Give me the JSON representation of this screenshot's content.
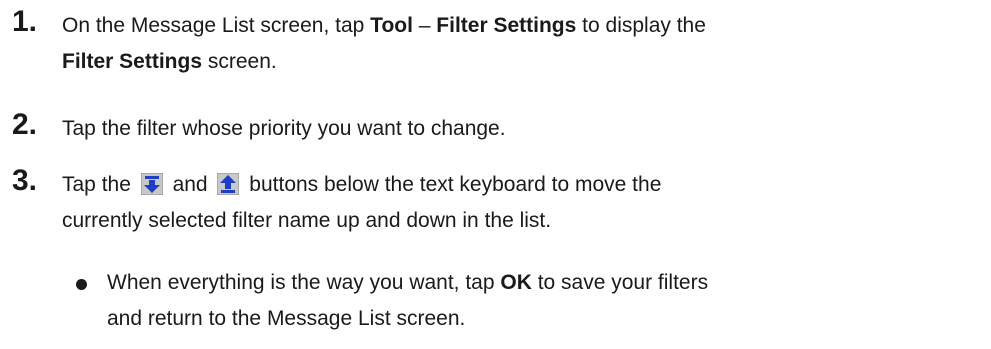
{
  "steps": [
    {
      "number": "1.",
      "line1": {
        "prefix": "On the Message List screen, tap ",
        "bold1": "Tool",
        "sep": " – ",
        "bold2": "Filter Settings",
        "suffix": " to display the"
      },
      "line2": {
        "bold": "Filter Settings",
        "suffix": " screen."
      }
    },
    {
      "number": "2.",
      "text": "Tap the filter whose priority you want to change."
    },
    {
      "number": "3.",
      "line1": {
        "prefix": "Tap the ",
        "icon1": "move-down-icon",
        "middle": " and ",
        "icon2": "move-up-icon",
        "suffix": " buttons below the text keyboard to move the"
      },
      "line2": "currently selected filter name up and down in the list."
    }
  ],
  "bullet": {
    "line1": {
      "prefix": "When everything is the way you want, tap ",
      "bold": "OK",
      "suffix": " to save your filters"
    },
    "line2": "and return to the Message List screen."
  },
  "colors": {
    "text": "#1a1a1a",
    "icon_fill": "#1e3fc4",
    "icon_bg": "#c8c8c8"
  }
}
